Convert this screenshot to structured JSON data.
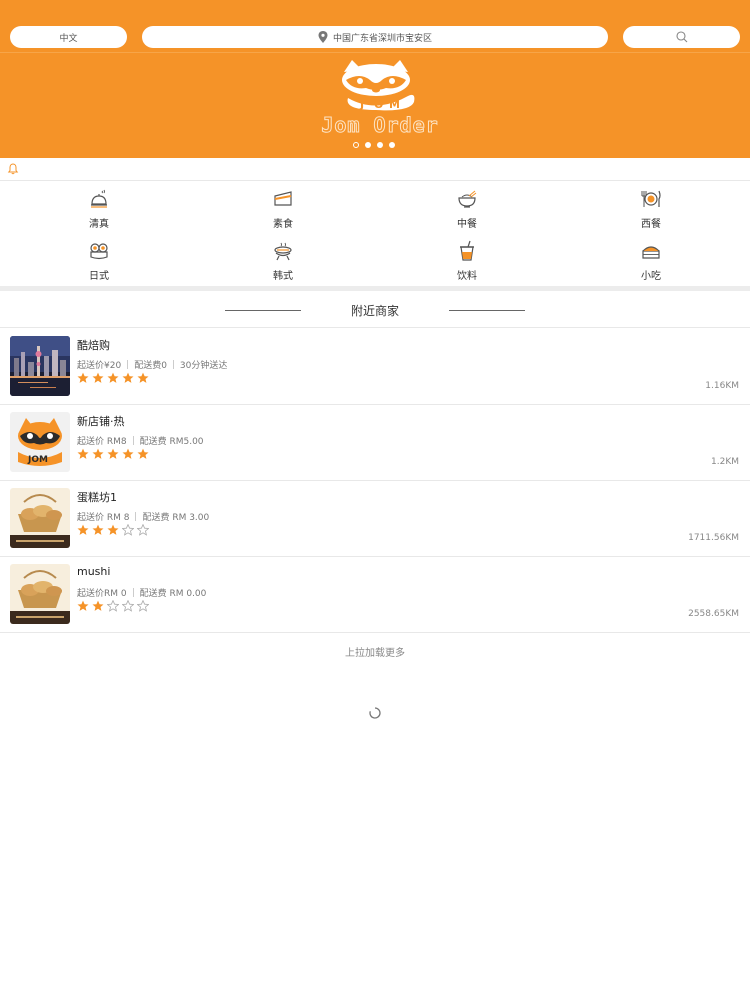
{
  "header": {
    "language": "中文",
    "location": "中国广东省深圳市宝安区",
    "brand": "Jom Order",
    "banner_dots": 4,
    "banner_active_index": 0
  },
  "colors": {
    "accent": "#f59328",
    "star": "#f59328"
  },
  "categories": [
    {
      "label": "清真",
      "icon": "cloche-icon"
    },
    {
      "label": "素食",
      "icon": "cake-slice-icon"
    },
    {
      "label": "中餐",
      "icon": "noodle-bowl-icon"
    },
    {
      "label": "西餐",
      "icon": "plate-cutlery-icon"
    },
    {
      "label": "日式",
      "icon": "sushi-icon"
    },
    {
      "label": "韩式",
      "icon": "bbq-grill-icon"
    },
    {
      "label": "饮料",
      "icon": "drink-cup-icon"
    },
    {
      "label": "小吃",
      "icon": "snack-cake-icon"
    }
  ],
  "nearby": {
    "title": "附近商家"
  },
  "merchants": [
    {
      "name": "酷焙购",
      "min_price": "起送价¥20",
      "delivery_fee": "配送费0",
      "delivery_time": "30分钟送达",
      "rating": 5,
      "distance": "1.16KM",
      "image": "city-skyline"
    },
    {
      "name": "新店铺·热",
      "min_price": "起送价 RM8",
      "delivery_fee": "配送费 RM5.00",
      "delivery_time": "",
      "rating": 5,
      "distance": "1.2KM",
      "image": "raccoon-logo"
    },
    {
      "name": "蛋糕坊1",
      "min_price": "起送价 RM 8",
      "delivery_fee": "配送费 RM 3.00",
      "delivery_time": "",
      "rating": 3,
      "distance": "1711.56KM",
      "image": "bread-basket"
    },
    {
      "name": "mushi",
      "min_price": "起送价RM 0",
      "delivery_fee": "配送费 RM 0.00",
      "delivery_time": "",
      "rating": 2,
      "distance": "2558.65KM",
      "image": "bread-basket"
    }
  ],
  "footer": {
    "load_more": "上拉加载更多"
  }
}
